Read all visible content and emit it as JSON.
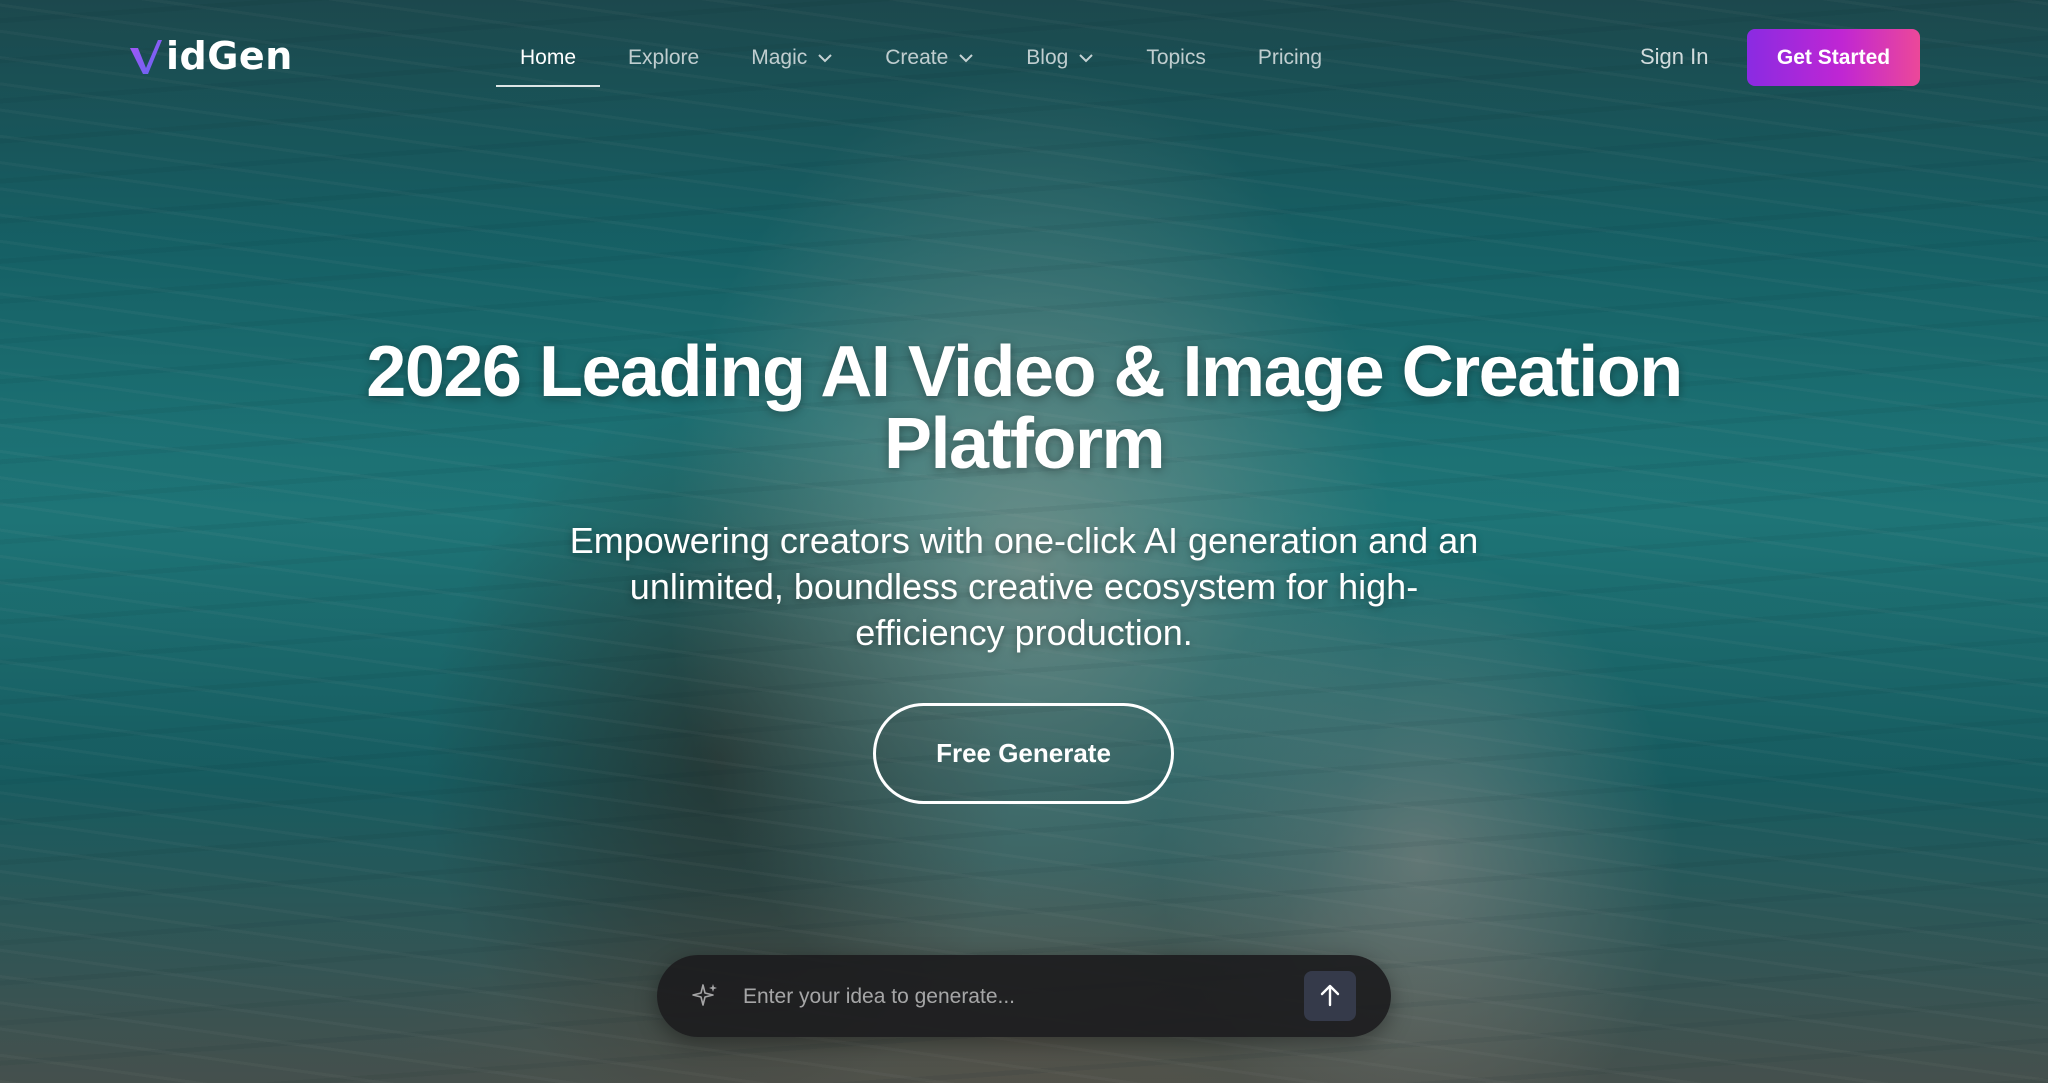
{
  "brand": {
    "name": "idGen",
    "logo_mark": "v-icon"
  },
  "nav": {
    "items": [
      {
        "label": "Home",
        "active": true,
        "dropdown": false
      },
      {
        "label": "Explore",
        "active": false,
        "dropdown": false
      },
      {
        "label": "Magic",
        "active": false,
        "dropdown": true
      },
      {
        "label": "Create",
        "active": false,
        "dropdown": true
      },
      {
        "label": "Blog",
        "active": false,
        "dropdown": true
      },
      {
        "label": "Topics",
        "active": false,
        "dropdown": false
      },
      {
        "label": "Pricing",
        "active": false,
        "dropdown": false
      }
    ],
    "sign_in": "Sign In",
    "get_started": "Get Started"
  },
  "hero": {
    "title_line1": "2026 Leading AI Video & Image Creation",
    "title_line2": "Platform",
    "subtitle_line1": "Empowering creators with one-click AI generation and an",
    "subtitle_line2": "unlimited, boundless creative ecosystem for high-",
    "subtitle_line3": "efficiency production.",
    "cta": "Free Generate"
  },
  "prompt": {
    "placeholder": "Enter your idea to generate...",
    "value": ""
  },
  "icons": {
    "chevron": "chevron-down-icon",
    "sparkle": "sparkle-icon",
    "submit": "arrow-up-icon"
  },
  "colors": {
    "accent_start": "#8a2be2",
    "accent_end": "#ec4899",
    "prompt_bar": "#1c1c1e",
    "submit_button": "#353a4a"
  }
}
